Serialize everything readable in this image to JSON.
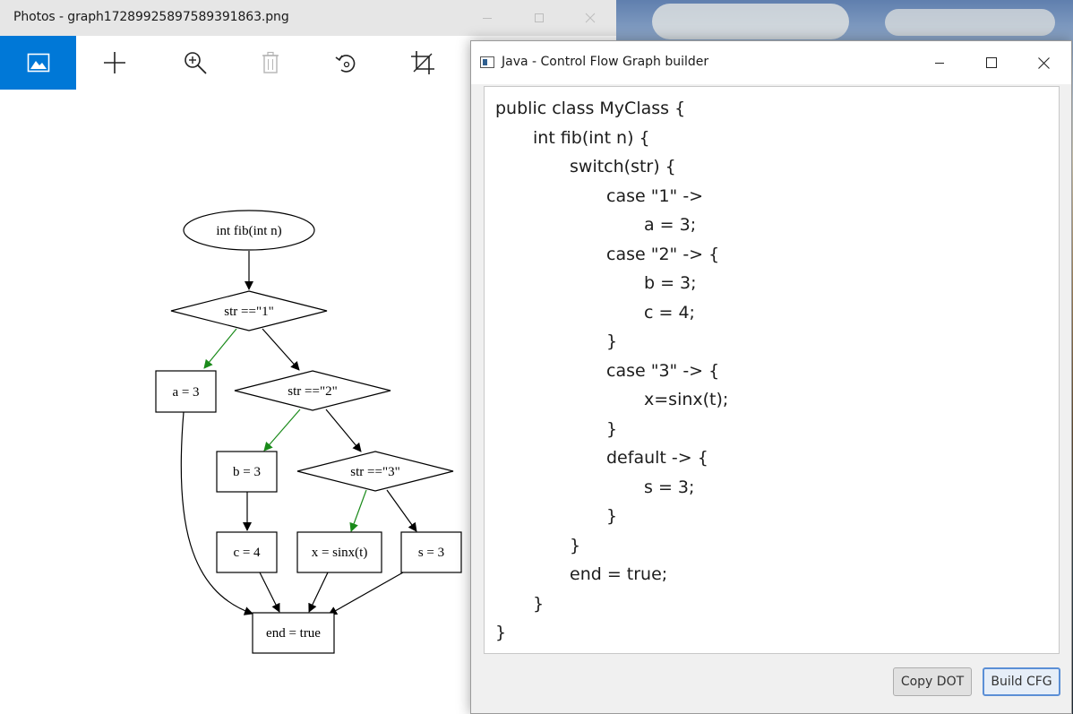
{
  "photos": {
    "title": "Photos - graph17289925897589391863.png",
    "toolbar": [
      {
        "icon": "image-icon",
        "active": true
      },
      {
        "icon": "add-icon"
      },
      {
        "icon": "zoom-in-icon"
      },
      {
        "icon": "delete-icon"
      },
      {
        "icon": "rotate-icon"
      },
      {
        "icon": "crop-icon"
      }
    ],
    "graph": {
      "nodes": {
        "start": "int fib(int n)",
        "d1": "str ==\"1\"",
        "a": "a = 3",
        "d2": "str ==\"2\"",
        "b": "b = 3",
        "d3": "str ==\"3\"",
        "c": "c = 4",
        "x": "x = sinx(t)",
        "s": "s = 3",
        "end": "end = true"
      }
    }
  },
  "java": {
    "title": "Java - Control Flow Graph builder",
    "code_lines": [
      "public class MyClass {",
      "int fib(int n) {",
      "switch(str) {",
      "case \"1\" ->",
      "a = 3;",
      "case \"2\" -> {",
      "b = 3;",
      "c = 4;",
      "}",
      "case \"3\" -> {",
      "x=sinx(t);",
      "}",
      "default -> {",
      "s = 3;",
      "}",
      "}",
      "end = true;",
      "}",
      "}"
    ],
    "buttons": {
      "copy_dot": "Copy DOT",
      "build_cfg": "Build CFG"
    }
  },
  "colors": {
    "accent": "#0078d7",
    "true_edge": "#1a8a1a",
    "edge": "#000000"
  }
}
